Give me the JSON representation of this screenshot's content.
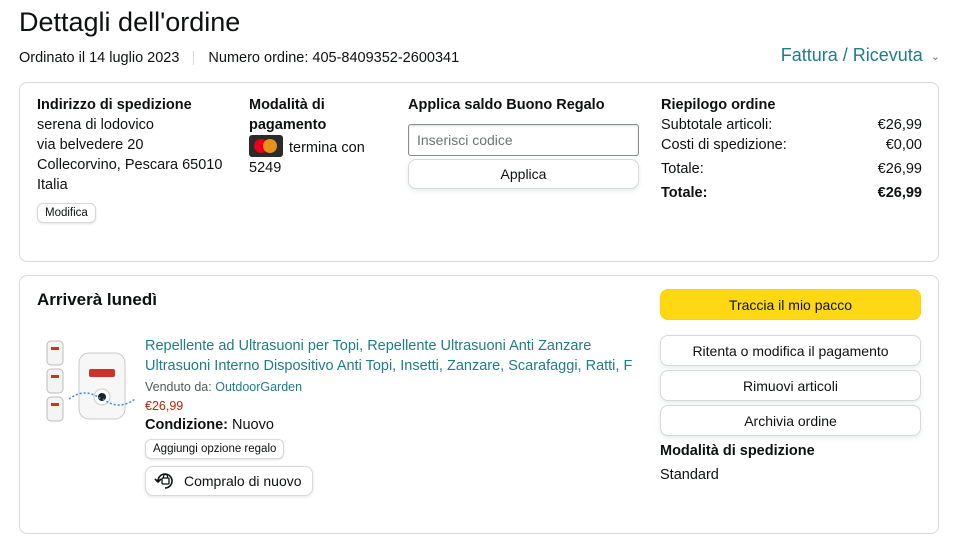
{
  "header": {
    "title": "Dettagli dell'ordine",
    "ordered_on": "Ordinato il 14 luglio 2023",
    "order_number": "Numero ordine: 405-8409352-2600341",
    "invoice_link": "Fattura / Ricevuta"
  },
  "summary": {
    "shipping_address": {
      "title": "Indirizzo di spedizione",
      "lines": [
        "serena di lodovico",
        "via belvedere 20",
        "Collecorvino, Pescara 65010",
        "Italia"
      ],
      "edit_label": "Modifica"
    },
    "payment": {
      "title": "Modalità di pagamento",
      "card_text": "termina con 5249"
    },
    "gift_card": {
      "title": "Applica saldo Buono Regalo",
      "placeholder": "Inserisci codice",
      "apply_label": "Applica"
    },
    "order_recap": {
      "title": "Riepilogo ordine",
      "rows": [
        {
          "label": "Subtotale articoli:",
          "value": "€26,99"
        },
        {
          "label": "Costi di spedizione:",
          "value": "€0,00"
        },
        {
          "label": "Totale:",
          "value": "€26,99"
        }
      ],
      "grand_total": {
        "label": "Totale:",
        "value": "€26,99"
      }
    }
  },
  "shipment": {
    "arrival": "Arriverà lunedì",
    "product": {
      "title": "Repellente ad Ultrasuoni per Topi, Repellente Ultrasuoni Anti Zanzare Ultrasuoni Interno Dispositivo Anti Topi, Insetti, Zanzare, Scarafaggi, Ratti, F",
      "sold_by_label": "Venduto da:",
      "seller": "OutdoorGarden",
      "price": "€26,99",
      "condition_label": "Condizione:",
      "condition_value": "Nuovo",
      "gift_option": "Aggiungi opzione regalo",
      "buy_again": "Compralo di nuovo"
    },
    "actions": {
      "track": "Traccia il mio pacco",
      "retry_payment": "Ritenta o modifica il pagamento",
      "remove_items": "Rimuovi articoli",
      "archive": "Archivia ordine"
    },
    "shipping_mode": {
      "title": "Modalità di spedizione",
      "value": "Standard"
    }
  },
  "colors": {
    "link": "#1e7d89",
    "price": "#b12704",
    "primary_button": "#ffd814",
    "border": "#d5d9d9"
  }
}
